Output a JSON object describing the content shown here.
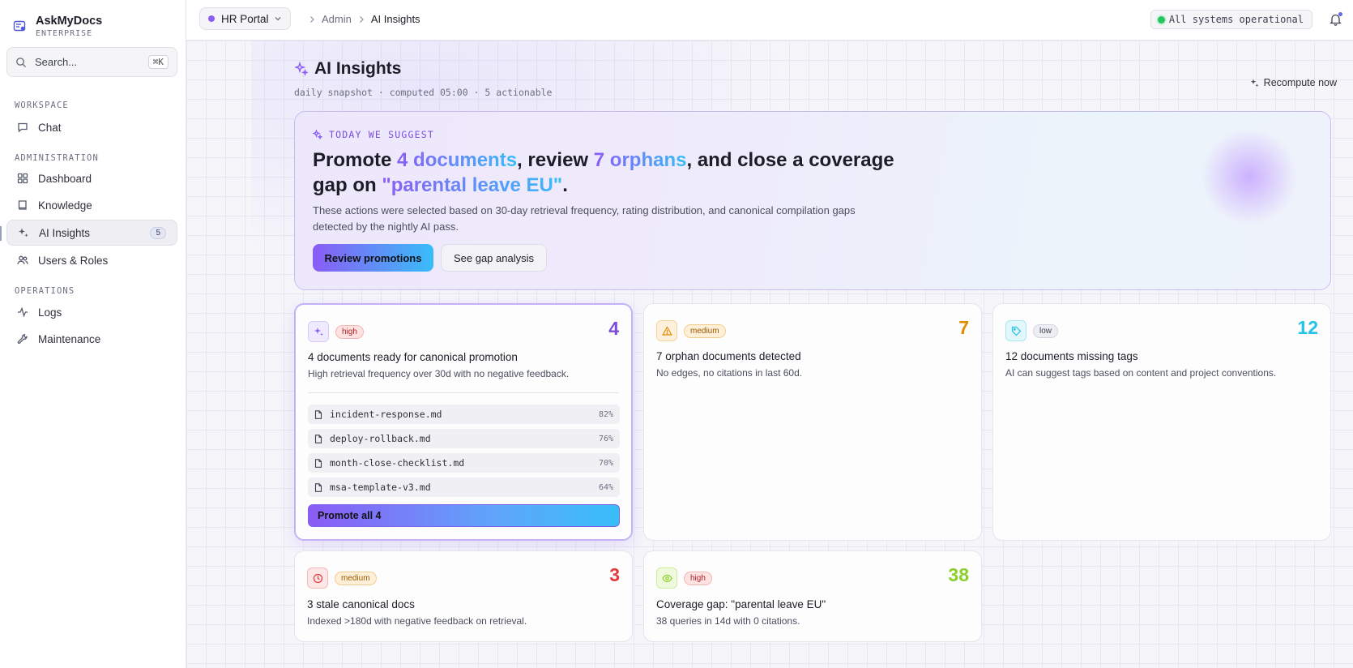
{
  "brand": {
    "name": "AskMyDocs",
    "sub": "ENTERPRISE"
  },
  "search": {
    "placeholder": "Search...",
    "shortcut": "⌘K"
  },
  "nav": {
    "workspace_label": "WORKSPACE",
    "administration_label": "ADMINISTRATION",
    "operations_label": "OPERATIONS",
    "items": {
      "chat": "Chat",
      "dashboard": "Dashboard",
      "knowledge": "Knowledge",
      "ai_insights": "AI Insights",
      "ai_insights_badge": "5",
      "users_roles": "Users & Roles",
      "logs": "Logs",
      "maintenance": "Maintenance"
    },
    "active": "ai_insights"
  },
  "topbar": {
    "portal": "HR Portal",
    "breadcrumb": [
      "Admin",
      "AI Insights"
    ],
    "status": "All systems operational"
  },
  "page": {
    "title": "AI Insights",
    "subtitle": "daily snapshot · computed 05:00 · 5 actionable",
    "recompute": "Recompute now"
  },
  "hero": {
    "eyebrow": "TODAY WE SUGGEST",
    "title_parts": {
      "p1": "Promote ",
      "h1": "4 documents",
      "p2": ", review ",
      "h2": "7 orphans",
      "p3": ", and close a coverage gap on ",
      "h3": "\"parental leave EU\"",
      "p4": "."
    },
    "description": "These actions were selected based on 30-day retrieval frequency, rating distribution, and canonical compilation gaps detected by the nightly AI pass.",
    "primary_button": "Review promotions",
    "secondary_button": "See gap analysis"
  },
  "cards": {
    "promotion": {
      "severity": "high",
      "count": "4",
      "title": "4 documents ready for canonical promotion",
      "description": "High retrieval frequency over 30d with no negative feedback.",
      "docs": [
        {
          "name": "incident-response.md",
          "pct": "82%"
        },
        {
          "name": "deploy-rollback.md",
          "pct": "76%"
        },
        {
          "name": "month-close-checklist.md",
          "pct": "70%"
        },
        {
          "name": "msa-template-v3.md",
          "pct": "64%"
        }
      ],
      "action": "Promote all 4"
    },
    "orphans": {
      "severity": "medium",
      "count": "7",
      "title": "7 orphan documents detected",
      "description": "No edges, no citations in last 60d."
    },
    "tags": {
      "severity": "low",
      "count": "12",
      "title": "12 documents missing tags",
      "description": "AI can suggest tags based on content and project conventions."
    },
    "stale": {
      "severity": "medium",
      "count": "3",
      "title": "3 stale canonical docs",
      "description": "Indexed >180d with negative feedback on retrieval."
    },
    "coverage": {
      "severity": "high",
      "count": "38",
      "title": "Coverage gap: \"parental leave EU\"",
      "description": "38 queries in 14d with 0 citations."
    }
  },
  "colors": {
    "accent": "#8b5cf6",
    "accent_2": "#38bdf8",
    "count_promotion": "#7c4dda",
    "count_orphans": "#e08a00",
    "count_tags": "#22c3e6",
    "count_stale": "#e5393d",
    "count_coverage": "#8ccf2a"
  }
}
